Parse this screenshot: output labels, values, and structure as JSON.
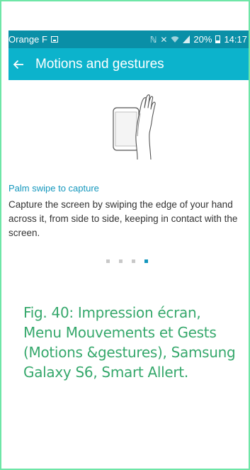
{
  "status_bar": {
    "carrier": "Orange F",
    "icons": [
      "sim-icon",
      "nfc-icon",
      "mute-icon",
      "wifi-icon",
      "signal-icon",
      "battery-icon"
    ],
    "battery": "20%",
    "time": "14:17"
  },
  "app_bar": {
    "back_icon": "arrow-left-icon",
    "title": "Motions and gestures"
  },
  "feature": {
    "illustration": "palm-swipe-hand-phone",
    "title": "Palm swipe to capture",
    "description": "Capture the screen by swiping the edge of your hand across it, from side to side, keeping in contact with the screen."
  },
  "pager": {
    "total": 4,
    "active": 4
  },
  "caption": "Fig. 40: Impression écran, Menu Mouvements et Gests (Motions &gestures), Samsung Galaxy S6, Smart Allert.",
  "colors": {
    "status_bar": "#0a8fa7",
    "app_bar": "#0cb3cc",
    "accent": "#1497bd",
    "caption": "#36a86c",
    "frame_border": "#6ee6a7"
  }
}
